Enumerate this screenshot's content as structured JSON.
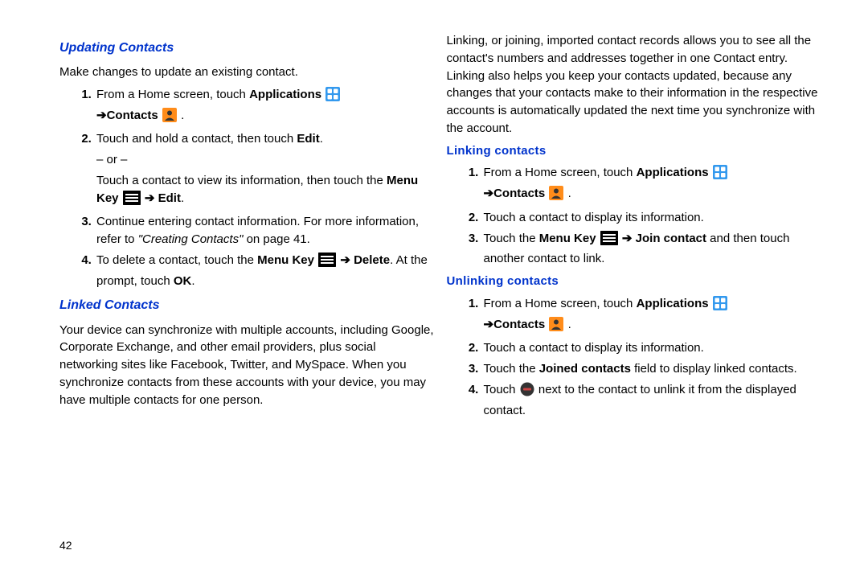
{
  "left": {
    "h1": "Updating Contacts",
    "intro": "Make changes to update an existing contact.",
    "li1_a": "From a Home screen, touch ",
    "li1_b": "Applications",
    "li1_c": " ",
    "li1_d": "➔Contacts",
    "li1_e": " .",
    "li2_a": "Touch and hold a contact, then touch ",
    "li2_b": "Edit",
    "li2_c": ".",
    "li2_or": "– or –",
    "li2_d": "Touch a contact to view its information, then touch the ",
    "li2_e": "Menu Key",
    "li2_f": " ➔ ",
    "li2_g": "Edit",
    "li2_h": ".",
    "li3_a": "Continue entering contact information. For more information, refer to ",
    "li3_b": "\"Creating Contacts\"",
    "li3_c": " on page 41.",
    "li4_a": "To delete a contact, touch the ",
    "li4_b": "Menu Key",
    "li4_c": " ➔ ",
    "li4_d": "Delete",
    "li4_e": ". At the prompt, touch ",
    "li4_f": "OK",
    "li4_g": ".",
    "h2": "Linked Contacts",
    "p2": "Your device can synchronize with multiple accounts, including Google, Corporate Exchange, and other email providers, plus social networking sites like Facebook, Twitter, and MySpace. When you synchronize contacts from these accounts with your device, you may have multiple contacts for one person."
  },
  "right": {
    "p1": "Linking, or joining, imported contact records allows you to see all the contact's numbers and addresses together in one Contact entry. Linking also helps you keep your contacts updated, because any changes that your contacts make to their information in the respective accounts is automatically updated the next time you synchronize with the account.",
    "h_link": "Linking contacts",
    "link_li1_a": "From a Home screen, touch ",
    "link_li1_b": "Applications",
    "link_li1_c": " ",
    "link_li1_d": "➔Contacts",
    "link_li1_e": " .",
    "link_li2": "Touch a contact to display its information.",
    "link_li3_a": "Touch the ",
    "link_li3_b": "Menu Key",
    "link_li3_c": " ➔ ",
    "link_li3_d": "Join contact",
    "link_li3_e": " and then touch another contact to link.",
    "h_unlink": "Unlinking contacts",
    "un_li1_a": "From a Home screen, touch ",
    "un_li1_b": "Applications",
    "un_li1_c": " ",
    "un_li1_d": "➔Contacts",
    "un_li1_e": " .",
    "un_li2": "Touch a contact to display its information.",
    "un_li3_a": "Touch the ",
    "un_li3_b": "Joined contacts",
    "un_li3_c": " field to display linked contacts.",
    "un_li4_a": "Touch ",
    "un_li4_b": " next to the contact to unlink it from the displayed contact."
  },
  "page_number": "42"
}
